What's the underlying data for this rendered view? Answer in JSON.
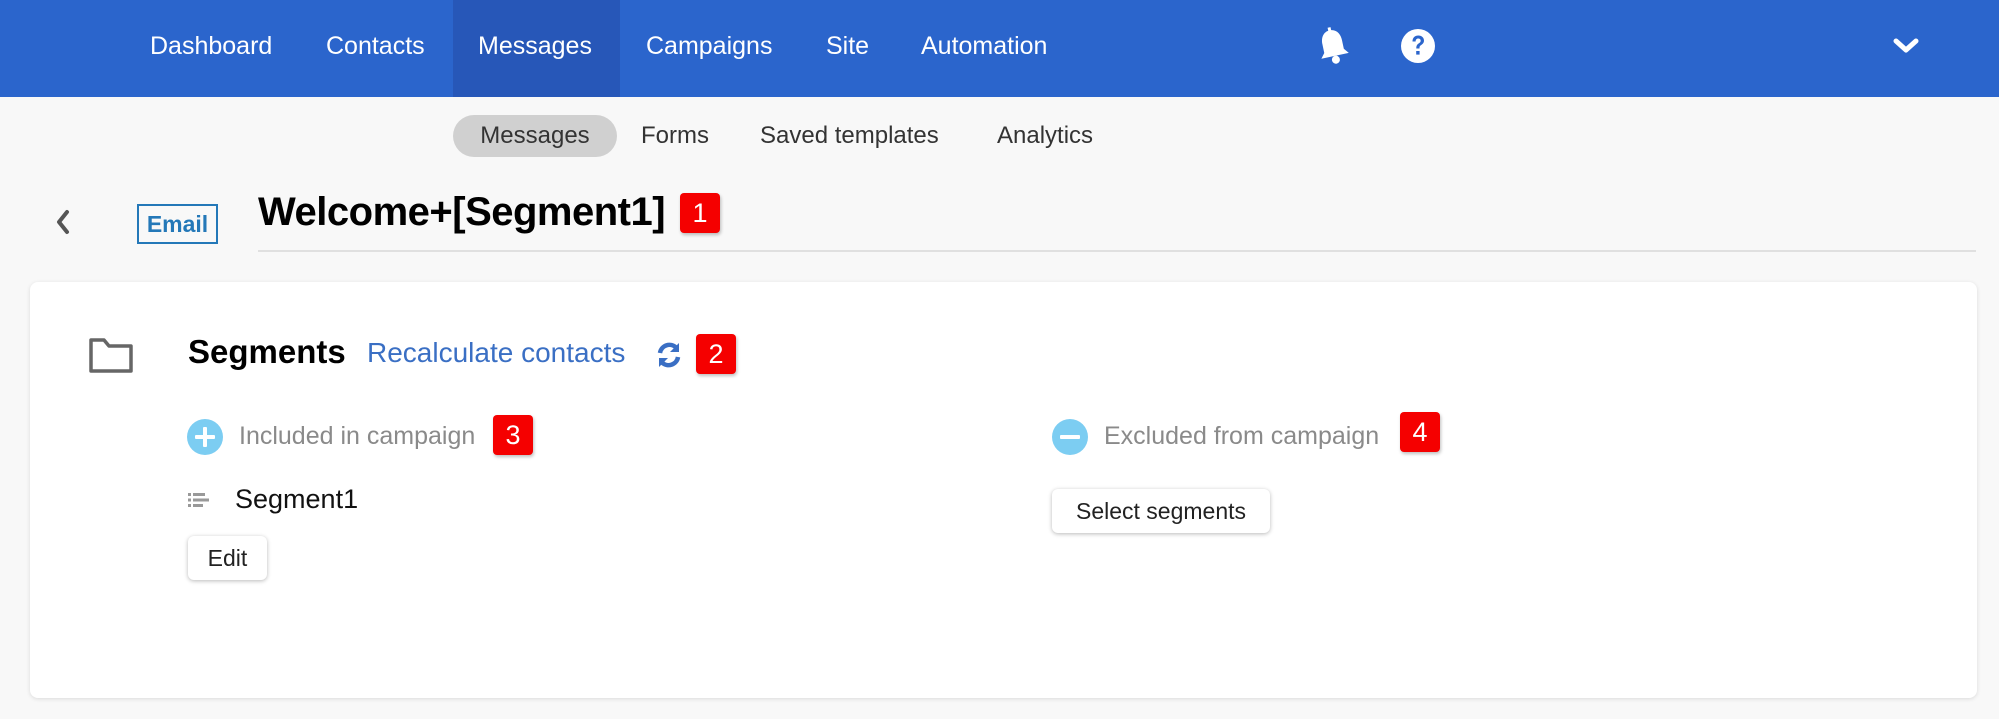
{
  "topnav": {
    "items": [
      {
        "label": "Dashboard",
        "active": false
      },
      {
        "label": "Contacts",
        "active": false
      },
      {
        "label": "Messages",
        "active": true
      },
      {
        "label": "Campaigns",
        "active": false
      },
      {
        "label": "Site",
        "active": false
      },
      {
        "label": "Automation",
        "active": false
      }
    ],
    "icons": {
      "notifications": "bell-icon",
      "help": "question-circle-icon",
      "account_menu": "chevron-down-icon"
    },
    "colors": {
      "background": "#2B65CC",
      "active_background": "#2757B8"
    }
  },
  "subnav": {
    "items": [
      {
        "label": "Messages",
        "active": true
      },
      {
        "label": "Forms",
        "active": false
      },
      {
        "label": "Saved templates",
        "active": false
      },
      {
        "label": "Analytics",
        "active": false
      }
    ]
  },
  "header": {
    "back_icon": "chevron-left-icon",
    "type_badge": "Email",
    "title": "Welcome+[Segment1]"
  },
  "markers": [
    "1",
    "2",
    "3",
    "4"
  ],
  "segments": {
    "section_icon": "folder-icon",
    "title": "Segments",
    "recalculate_label": "Recalculate contacts",
    "recalculate_icon": "refresh-icon",
    "included": {
      "icon": "plus-circle-icon",
      "label": "Included in campaign",
      "items": [
        {
          "name": "Segment1",
          "icon": "list-icon"
        }
      ],
      "button_label": "Edit"
    },
    "excluded": {
      "icon": "minus-circle-icon",
      "label": "Excluded from campaign",
      "items": [],
      "button_label": "Select segments"
    }
  },
  "colors": {
    "link": "#3A6FC4",
    "marker": "#F50000",
    "badge": "#2478B8",
    "circle_icon": "#7CCDF2"
  }
}
